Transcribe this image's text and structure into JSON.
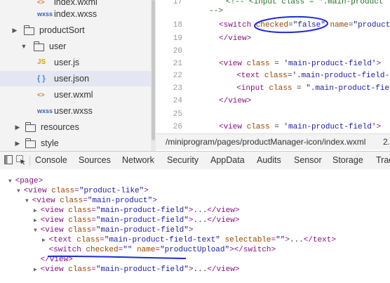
{
  "file_tree": {
    "items": [
      {
        "label": "index.wxml",
        "icon": "wxml-file-icon",
        "icon_text": "<>"
      },
      {
        "label": "index.wxss",
        "icon": "wxss-file-icon",
        "icon_text": "wxss"
      },
      {
        "label": "productSort",
        "icon": "folder-icon",
        "expanded": false
      },
      {
        "label": "user",
        "icon": "folder-open-icon",
        "expanded": true
      },
      {
        "label": "user.js",
        "icon": "js-file-icon",
        "icon_text": "JS"
      },
      {
        "label": "user.json",
        "icon": "json-file-icon",
        "icon_text": "{ }",
        "selected": true
      },
      {
        "label": "user.wxml",
        "icon": "wxml-file-icon",
        "icon_text": "<>"
      },
      {
        "label": "user.wxss",
        "icon": "wxss-file-icon",
        "icon_text": "wxss"
      },
      {
        "label": "resources",
        "icon": "folder-icon",
        "expanded": false
      },
      {
        "label": "style",
        "icon": "folder-icon",
        "expanded": false
      }
    ]
  },
  "editor": {
    "lines": [
      {
        "num": "17",
        "parts": [
          [
            "cmt",
            "<!-- <input class = \".main-product"
          ]
        ]
      },
      {
        "num": "",
        "parts": [
          [
            "cmt",
            "-->"
          ]
        ]
      },
      {
        "num": "18",
        "parts": [
          [
            "tag",
            "<switch "
          ],
          [
            "attr",
            "checked"
          ],
          [
            "txt",
            "="
          ],
          [
            "str",
            "\"false\""
          ],
          [
            "txt",
            " "
          ],
          [
            "attr",
            "name"
          ],
          [
            "txt",
            "="
          ],
          [
            "str",
            "\"product"
          ]
        ]
      },
      {
        "num": "19",
        "parts": [
          [
            "tag",
            "</view>"
          ]
        ]
      },
      {
        "num": "20",
        "parts": []
      },
      {
        "num": "21",
        "parts": [
          [
            "tag",
            "<view "
          ],
          [
            "attr",
            "class"
          ],
          [
            "txt",
            " = "
          ],
          [
            "str",
            "'main-product-field'"
          ],
          [
            "tag",
            ">"
          ]
        ]
      },
      {
        "num": "22",
        "parts": [
          [
            "txt",
            "  "
          ],
          [
            "tag",
            "<text "
          ],
          [
            "attr",
            "class"
          ],
          [
            "txt",
            "="
          ],
          [
            "str",
            "'.main-product-field-te"
          ]
        ]
      },
      {
        "num": "23",
        "parts": [
          [
            "txt",
            "  "
          ],
          [
            "tag",
            "<input "
          ],
          [
            "attr",
            "class"
          ],
          [
            "txt",
            " = "
          ],
          [
            "str",
            "\".main-product-field"
          ]
        ]
      },
      {
        "num": "24",
        "parts": [
          [
            "tag",
            "</view>"
          ]
        ]
      },
      {
        "num": "25",
        "parts": []
      },
      {
        "num": "26",
        "parts": [
          [
            "tag",
            "<view "
          ],
          [
            "attr",
            "class"
          ],
          [
            "txt",
            " = "
          ],
          [
            "str",
            "'main-product-field'"
          ],
          [
            "tag",
            ">"
          ]
        ]
      }
    ]
  },
  "status_bar": {
    "path": "/miniprogram/pages/productManager-icon/index.wxml",
    "extra": "2."
  },
  "devtools": {
    "tabs": [
      "Console",
      "Sources",
      "Network",
      "Security",
      "AppData",
      "Audits",
      "Sensor",
      "Storage",
      "Trac"
    ]
  },
  "elements": {
    "rows": [
      {
        "indent": 0,
        "tri": "▼",
        "parts": [
          [
            "etag",
            "<page>"
          ]
        ]
      },
      {
        "indent": 1,
        "tri": "▼",
        "parts": [
          [
            "etag",
            "<view "
          ],
          [
            "eattr",
            "class"
          ],
          [
            "etag",
            "="
          ],
          [
            "eval",
            "\"product-like\""
          ],
          [
            "etag",
            ">"
          ]
        ]
      },
      {
        "indent": 2,
        "tri": "▼",
        "parts": [
          [
            "etag",
            "<view "
          ],
          [
            "eattr",
            "class"
          ],
          [
            "etag",
            "="
          ],
          [
            "eval",
            "\"main-product\""
          ],
          [
            "etag",
            ">"
          ]
        ]
      },
      {
        "indent": 3,
        "tri": "▶",
        "parts": [
          [
            "etag",
            "<view "
          ],
          [
            "eattr",
            "class"
          ],
          [
            "etag",
            "="
          ],
          [
            "eval",
            "\"main-product-field\""
          ],
          [
            "etag",
            ">"
          ],
          [
            "etxt",
            "..."
          ],
          [
            "etag",
            "</view>"
          ]
        ]
      },
      {
        "indent": 3,
        "tri": "▶",
        "parts": [
          [
            "etag",
            "<view "
          ],
          [
            "eattr",
            "class"
          ],
          [
            "etag",
            "="
          ],
          [
            "eval",
            "\"main-product-field\""
          ],
          [
            "etag",
            ">"
          ],
          [
            "etxt",
            "..."
          ],
          [
            "etag",
            "</view>"
          ]
        ]
      },
      {
        "indent": 3,
        "tri": "▼",
        "parts": [
          [
            "etag",
            "<view "
          ],
          [
            "eattr",
            "class"
          ],
          [
            "etag",
            "="
          ],
          [
            "eval",
            "\"main-product-field\""
          ],
          [
            "etag",
            ">"
          ]
        ]
      },
      {
        "indent": 4,
        "tri": "▶",
        "parts": [
          [
            "etag",
            "<text "
          ],
          [
            "eattr",
            "class"
          ],
          [
            "etag",
            "="
          ],
          [
            "eval",
            "\"main-product-field-text\""
          ],
          [
            "etxt",
            " "
          ],
          [
            "eattr",
            "selectable"
          ],
          [
            "etag",
            "="
          ],
          [
            "eval",
            "\"\""
          ],
          [
            "etag",
            ">"
          ],
          [
            "etxt",
            "..."
          ],
          [
            "etag",
            "</text>"
          ]
        ]
      },
      {
        "indent": 4,
        "tri": "",
        "parts": [
          [
            "etag",
            "<switch "
          ],
          [
            "eattr",
            "checked"
          ],
          [
            "etag",
            "="
          ],
          [
            "eval",
            "\"\""
          ],
          [
            "etxt",
            " "
          ],
          [
            "eattr",
            "name"
          ],
          [
            "etag",
            "="
          ],
          [
            "eval",
            "\"productUpload\""
          ],
          [
            "etag",
            "></switch>"
          ]
        ]
      },
      {
        "indent": 3,
        "tri": "",
        "parts": [
          [
            "etag",
            "</view>"
          ]
        ]
      },
      {
        "indent": 3,
        "tri": "▶",
        "parts": [
          [
            "etag",
            "<view "
          ],
          [
            "eattr",
            "class"
          ],
          [
            "etag",
            "="
          ],
          [
            "eval",
            "\"main-product-field\""
          ],
          [
            "etag",
            ">"
          ],
          [
            "etxt",
            "..."
          ],
          [
            "etag",
            "</view>"
          ]
        ]
      }
    ]
  },
  "annotation": {
    "color": "#1e2ad6"
  },
  "colors": {
    "accent": "#4a8bd8",
    "selected_row": "#e4e6f1"
  }
}
